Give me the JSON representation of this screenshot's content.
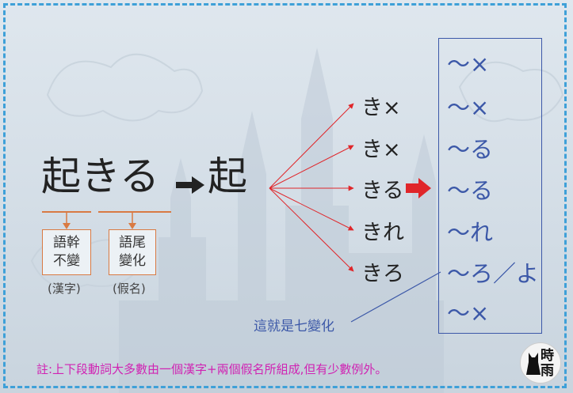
{
  "diagram": {
    "main_word": "起きる",
    "stem": "起",
    "branches": [
      "き×",
      "き×",
      "きる",
      "きれ",
      "きろ"
    ],
    "results": [
      "～×",
      "～×",
      "～る",
      "～る",
      "～れ",
      "～ろ／よ",
      "～×"
    ],
    "box_left": "語幹\n不變",
    "box_right": "語尾\n變化",
    "paren_left": "(漢字)",
    "paren_right": "(假名)",
    "seven_label": "這就是七變化",
    "note": "註:上下段動詞大多數由一個漢字+兩個假名所組成,但有少數例外。",
    "logo_chars": [
      "時",
      "雨"
    ],
    "colors": {
      "results": "#3c58a8",
      "arrows": "#e0262a",
      "boxes": "#d97a43",
      "note": "#d023b3",
      "border": "#3ea0d8"
    }
  }
}
